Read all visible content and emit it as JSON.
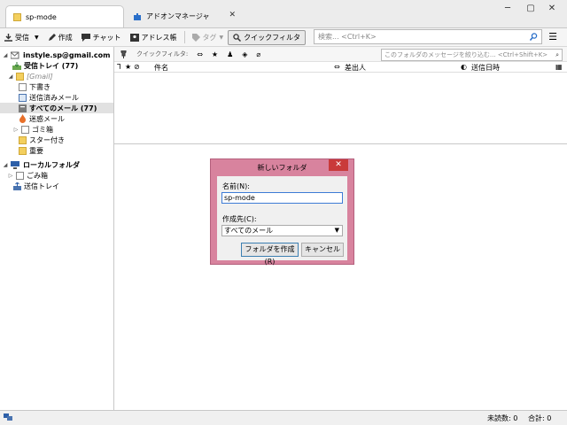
{
  "tabs": [
    {
      "label": "sp-mode",
      "icon": "folder-icon"
    },
    {
      "label": "アドオンマネージャ",
      "icon": "puzzle-icon"
    }
  ],
  "window_controls": {
    "minimize": "─",
    "maximize": "▢",
    "close": "✕"
  },
  "toolbar": {
    "receive": "受信",
    "compose": "作成",
    "chat": "チャット",
    "address_book": "アドレス帳",
    "tag": "タグ",
    "quick_filter": "クイックフィルタ"
  },
  "search": {
    "placeholder": "検索... <Ctrl+K>"
  },
  "quickfilter": {
    "label": "クイックフィルタ:",
    "placeholder": "このフォルダのメッセージを絞り込む... <Ctrl+Shift+K>"
  },
  "columns": {
    "subject": "件名",
    "from": "差出人",
    "date": "送信日時"
  },
  "folders": [
    {
      "label": "instyle.sp@gmail.com",
      "bold": true
    },
    {
      "label": "受信トレイ (77)",
      "bold": true
    },
    {
      "label": "[Gmail]",
      "italic": true
    },
    {
      "label": "下書き"
    },
    {
      "label": "送信済みメール"
    },
    {
      "label": "すべてのメール (77)",
      "bold": true
    },
    {
      "label": "迷惑メール"
    },
    {
      "label": "ゴミ箱"
    },
    {
      "label": "スター付き"
    },
    {
      "label": "重要"
    },
    {
      "label": "ローカルフォルダ",
      "bold": true
    },
    {
      "label": "ごみ箱"
    },
    {
      "label": "送信トレイ"
    }
  ],
  "dialog": {
    "title": "新しいフォルダ",
    "name_label": "名前(N):",
    "name_value": "sp-mode",
    "parent_label": "作成先(C):",
    "parent_value": "すべてのメール",
    "create_button": "フォルダを作成(R)",
    "cancel_button": "キャンセル"
  },
  "status": {
    "unread": "未読数: 0",
    "total": "合計: 0"
  }
}
